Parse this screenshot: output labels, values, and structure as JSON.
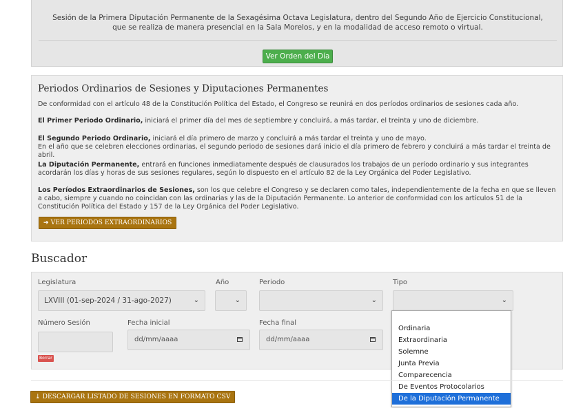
{
  "session_notice": {
    "text": "Sesión de la Primera Diputación Permanente de la Sexagésima Octava Legislatura, dentro del Segundo Año de Ejercicio Constitucional, que se realiza de manera presencial en la Sala Morelos, y en la modalidad de acceso remoto o virtual.",
    "button": "Ver Orden del Día"
  },
  "periods": {
    "title": "Periodos Ordinarios de Sesiones y Diputaciones Permanentes",
    "intro": "De conformidad con el artículo 48 de la Constitución Política del Estado, el Congreso se reunirá en dos períodos ordinarios de sesiones cada año.",
    "p1_bold": "El Primer Periodo Ordinario,",
    "p1_text": " iniciará el primer día del mes de septiembre y concluirá, a más tardar, el treinta y uno de diciembre.",
    "p2_bold": "El Segundo Periodo Ordinario,",
    "p2_text": " iniciará el día primero de marzo y concluirá a más tardar el treinta y uno de mayo.",
    "p2_line2": "En el año que se celebren elecciones ordinarias, el segundo periodo de sesiones dará inicio el día primero de febrero y concluirá a más tardar el treinta de abril.",
    "p3_bold": "La Diputación Permanente,",
    "p3_text": " entrará en funciones inmediatamente después de clausurados los trabajos de un período ordinario y sus integrantes acordarán los días y horas de sus sesiones regulares, según lo dispuesto en el artículo 82 de la Ley Orgánica del Poder Legislativo.",
    "p4_bold": "Los Períodos Extraordinarios de Sesiones,",
    "p4_text": " son los que celebre el Congreso y se declaren como tales, independientemente de la fecha en que se lleven a cabo, siempre y cuando no coincidan con las ordinarias y las de la Diputación Permanente. Lo anterior de conformidad con los artículos 51 de la Constitución Política del Estado y 157 de la Ley Orgánica del Poder Legislativo.",
    "extra_button": "VER PERIODOS EXTRAORDINARIOS",
    "extra_icon": "arrow-right-icon"
  },
  "buscador": {
    "title": "Buscador",
    "labels": {
      "legislatura": "Legislatura",
      "anio": "Año",
      "periodo": "Periodo",
      "tipo": "Tipo",
      "numero_sesion": "Número Sesión",
      "fecha_inicial": "Fecha inicial",
      "fecha_final": "Fecha final"
    },
    "legislatura_value": "LXVIII (01-sep-2024 / 31-ago-2027)",
    "date_placeholder": "dd/mm/aaaa",
    "borrar": "Borrar",
    "tipo_options": [
      "Ordinaria",
      "Extraordinaria",
      "Solemne",
      "Junta Previa",
      "Comparecencia",
      "De Eventos Protocolarios",
      "De la Diputación Permanente"
    ],
    "tipo_highlighted": "De la Diputación Permanente"
  },
  "csv_button": "DESCARGAR LISTADO DE SESIONES EN FORMATO CSV",
  "csv_icon": "download-icon",
  "colors": {
    "green": "#4cae4c",
    "gold": "#a97410",
    "red": "#d9534f",
    "highlight": "#1e6fd9"
  }
}
